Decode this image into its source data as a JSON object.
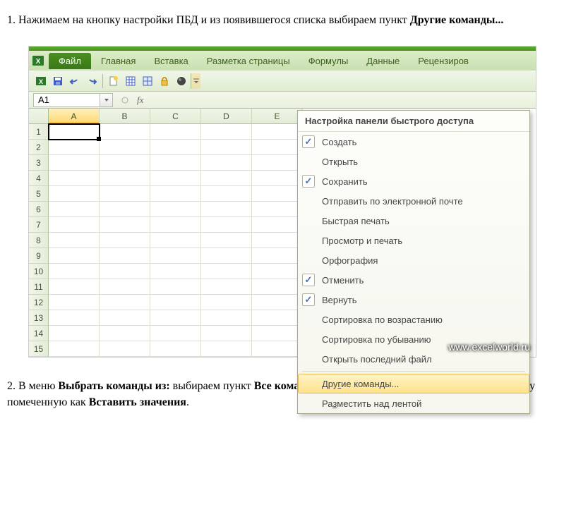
{
  "instruction1_pre": "1. Нажимаем на кнопку настройки ПБД и из появившегося списка выбираем пункт ",
  "instruction1_bold": "Другие команды...",
  "instruction2_pre": "2. В меню ",
  "instruction2_b1": "Выбрать команды из:",
  "instruction2_mid1": " выбираем пункт ",
  "instruction2_b2": "Все команды",
  "instruction2_mid2": " и из появившегося списка выбираем иконку помеченную как ",
  "instruction2_b3": "Вставить значения",
  "instruction2_end": ".",
  "ribbon": {
    "file": "Файл",
    "tabs": [
      "Главная",
      "Вставка",
      "Разметка страницы",
      "Формулы",
      "Данные",
      "Рецензиров"
    ]
  },
  "namebox": "A1",
  "columns": [
    "A",
    "B",
    "C",
    "D",
    "E"
  ],
  "rows": [
    "1",
    "2",
    "3",
    "4",
    "5",
    "6",
    "7",
    "8",
    "9",
    "10",
    "11",
    "12",
    "13",
    "14",
    "15"
  ],
  "menu": {
    "title": "Настройка панели быстрого доступа",
    "items": [
      {
        "label": "Создать",
        "checked": true
      },
      {
        "label": "Открыть",
        "checked": false
      },
      {
        "label": "Сохранить",
        "checked": true
      },
      {
        "label": "Отправить по электронной почте",
        "checked": false
      },
      {
        "label": "Быстрая печать",
        "checked": false
      },
      {
        "label": "Просмотр и печать",
        "checked": false
      },
      {
        "label": "Орфография",
        "checked": false
      },
      {
        "label": "Отменить",
        "checked": true
      },
      {
        "label": "Вернуть",
        "checked": true
      },
      {
        "label": "Сортировка по возрастанию",
        "checked": false
      },
      {
        "label": "Сортировка по убыванию",
        "checked": false
      },
      {
        "label": "Открыть последний файл",
        "checked": false
      }
    ],
    "more": {
      "pre": "Дру",
      "u": "г",
      "post": "ие команды..."
    },
    "place": {
      "pre": "Ра",
      "u": "з",
      "post": "местить над лентой"
    }
  },
  "watermark": "www.excelworld.ru"
}
